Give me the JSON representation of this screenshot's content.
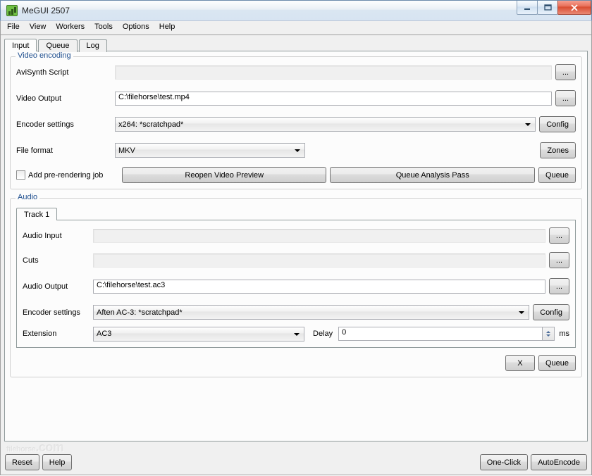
{
  "window": {
    "title": "MeGUI 2507"
  },
  "menu": {
    "file": "File",
    "view": "View",
    "workers": "Workers",
    "tools": "Tools",
    "options": "Options",
    "help": "Help"
  },
  "main_tabs": {
    "input": "Input",
    "queue": "Queue",
    "log": "Log"
  },
  "video": {
    "legend": "Video encoding",
    "avisynth_label": "AviSynth Script",
    "avisynth_value": "",
    "output_label": "Video Output",
    "output_value": "C:\\filehorse\\test.mp4",
    "encoder_label": "Encoder settings",
    "encoder_value": "x264: *scratchpad*",
    "config": "Config",
    "format_label": "File format",
    "format_value": "MKV",
    "zones": "Zones",
    "prerender_label": "Add pre-rendering job",
    "reopen": "Reopen Video Preview",
    "analysis": "Queue Analysis Pass",
    "queue": "Queue"
  },
  "audio": {
    "legend": "Audio",
    "track_tab": "Track 1",
    "input_label": "Audio Input",
    "input_value": "",
    "cuts_label": "Cuts",
    "cuts_value": "",
    "output_label": "Audio Output",
    "output_value": "C:\\filehorse\\test.ac3",
    "encoder_label": "Encoder settings",
    "encoder_value": "Aften AC-3: *scratchpad*",
    "config": "Config",
    "extension_label": "Extension",
    "extension_value": "AC3",
    "delay_label": "Delay",
    "delay_value": "0",
    "delay_unit": "ms",
    "x": "X",
    "queue": "Queue"
  },
  "footer": {
    "reset": "Reset",
    "help": "Help",
    "oneclick": "One-Click",
    "autoencode": "AutoEncode"
  },
  "browse": "...",
  "watermark": {
    "name": "filehorse",
    "tld": ".com"
  }
}
